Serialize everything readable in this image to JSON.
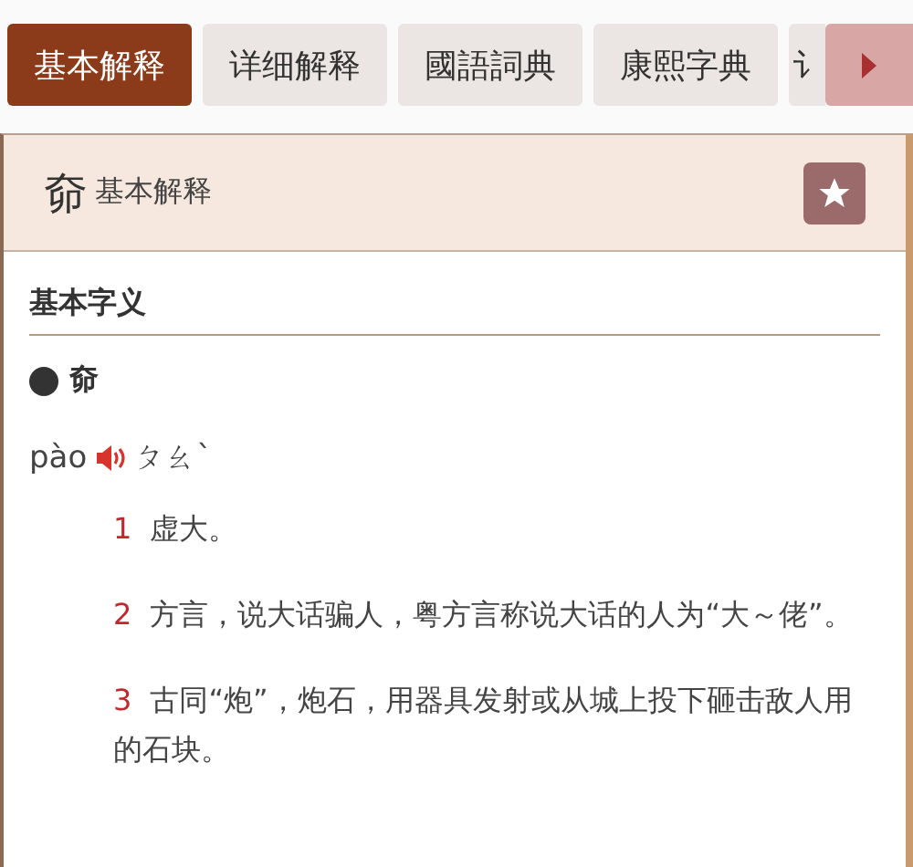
{
  "tabs": [
    {
      "label": "基本解释",
      "selected": true
    },
    {
      "label": "详细解释",
      "selected": false
    },
    {
      "label": "國語詞典",
      "selected": false
    },
    {
      "label": "康熙字典",
      "selected": false
    },
    {
      "label": "讠",
      "selected": false
    }
  ],
  "header": {
    "character": "奅",
    "title": "基本解释"
  },
  "section": {
    "heading": "基本字义",
    "entry": "奅",
    "pinyin": "pào",
    "zhuyin": "ㄆㄠˋ",
    "definitions": [
      {
        "number": "1",
        "text": "虚大。"
      },
      {
        "number": "2",
        "text": "方言，说大话骗人，粤方言称说大话的人为“大～佬”。"
      },
      {
        "number": "3",
        "text": "古同“炮”，炮石，用器具发射或从城上投下砸击敌人用的石块。"
      }
    ]
  }
}
